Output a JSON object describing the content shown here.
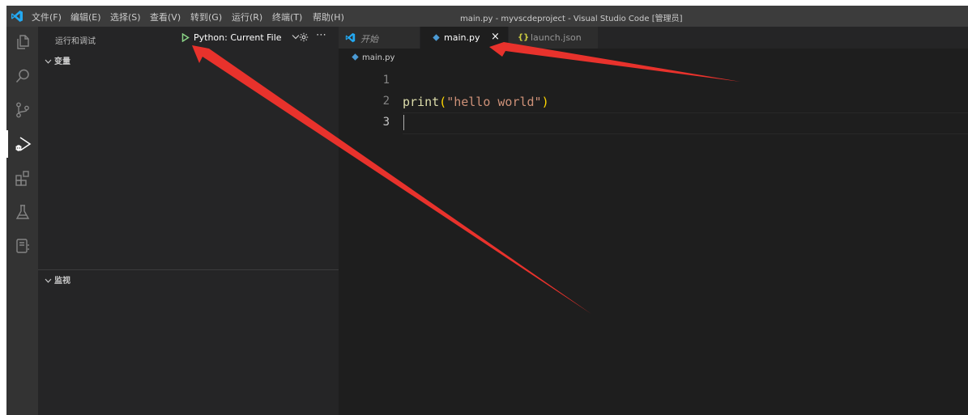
{
  "titlebar": {
    "menu": [
      {
        "label": "文件(F)"
      },
      {
        "label": "编辑(E)"
      },
      {
        "label": "选择(S)"
      },
      {
        "label": "查看(V)"
      },
      {
        "label": "转到(G)"
      },
      {
        "label": "运行(R)"
      },
      {
        "label": "终端(T)"
      },
      {
        "label": "帮助(H)"
      }
    ],
    "window_title": "main.py - myvscdeproject - Visual Studio Code [管理员]"
  },
  "activity_bar": {
    "icons": [
      "files-icon",
      "search-icon",
      "source-control-icon",
      "run-debug-icon",
      "extensions-icon",
      "testing-icon",
      "notebook-icon"
    ],
    "active": "run-debug-icon"
  },
  "sidebar": {
    "title": "运行和调试",
    "run_config": "Python: Current File",
    "sections": [
      {
        "label": "变量",
        "expanded": true
      },
      {
        "label": "监视",
        "expanded": true
      }
    ]
  },
  "editor": {
    "tabs": [
      {
        "label": "开始",
        "icon": "vscode-icon",
        "active": false,
        "italic": true
      },
      {
        "label": "main.py",
        "icon": "python-icon",
        "active": true,
        "close": "×"
      },
      {
        "label": "launch.json",
        "icon": "json-icon",
        "active": false
      }
    ],
    "breadcrumb": "main.py",
    "lines": [
      {
        "number": "1",
        "text": ""
      },
      {
        "number": "2",
        "fn": "print",
        "open": "(",
        "str": "\"hello world\"",
        "close": ")"
      },
      {
        "number": "3",
        "text": ""
      }
    ],
    "current_line": 3
  },
  "colors": {
    "accent_blue": "#007acc",
    "play_green": "#89d185",
    "annotation_red": "#e8322c",
    "editor_bg": "#1e1e1e",
    "sidebar_bg": "#252526"
  }
}
